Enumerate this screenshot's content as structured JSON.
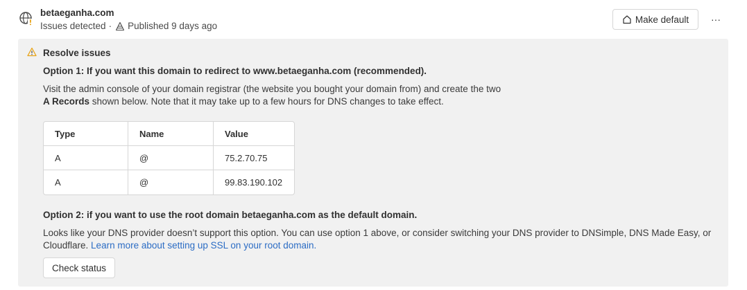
{
  "header": {
    "domain": "betaeganha.com",
    "status": "Issues detected",
    "separator": "·",
    "published": "Published 9 days ago",
    "make_default_label": "Make default",
    "more_label": "···"
  },
  "resolve": {
    "title": "Resolve issues",
    "option1": {
      "heading": "Option 1: If you want this domain to redirect to www.betaeganha.com (recommended).",
      "desc_line1": "Visit the admin console of your domain registrar (the website you bought your domain from) and create the two",
      "desc_bold": "A Records",
      "desc_line2_rest": " shown below. Note that it may take up to a few hours for DNS changes to take effect."
    },
    "table": {
      "headers": [
        "Type",
        "Name",
        "Value"
      ],
      "rows": [
        [
          "A",
          "@",
          "75.2.70.75"
        ],
        [
          "A",
          "@",
          "99.83.190.102"
        ]
      ]
    },
    "option2": {
      "heading": "Option 2: if you want to use the root domain betaeganha.com as the default domain.",
      "desc": "Looks like your DNS provider doesn’t support this option. You can use option 1 above, or consider switching your DNS provider to DNSimple, DNS Made Easy, or Cloudflare. ",
      "link": "Learn more about setting up SSL on your root domain."
    },
    "check_status_label": "Check status"
  },
  "colors": {
    "panel_bg": "#f1f1f1",
    "link": "#2b6cc4",
    "warning": "#e8a317"
  },
  "icons": {
    "domain": "globe-warning-icon",
    "published": "cone-icon",
    "make_default": "home-icon",
    "resolve": "warning-triangle-icon"
  }
}
